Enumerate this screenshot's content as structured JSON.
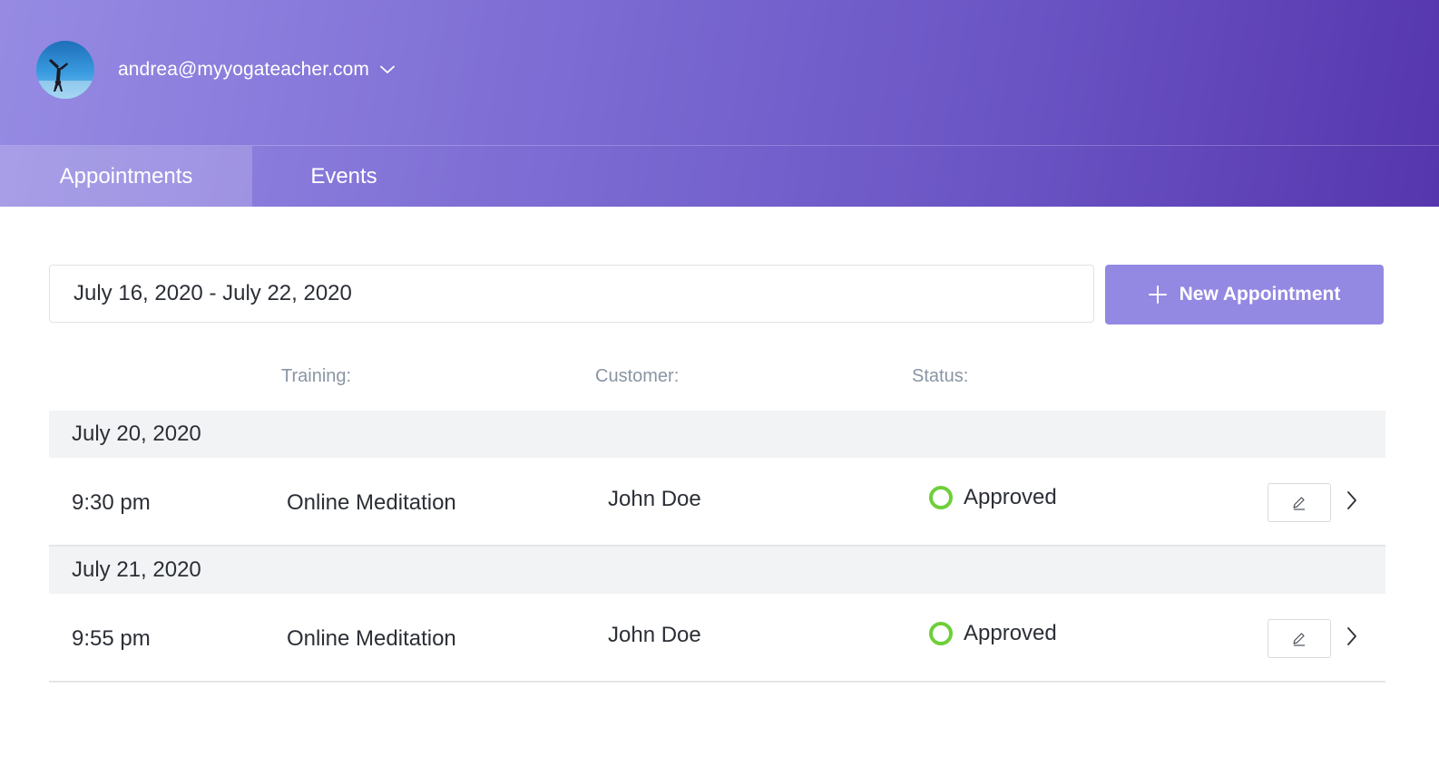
{
  "header": {
    "account_email": "andrea@myyogateacher.com",
    "avatar_icon": "avatar-image",
    "dropdown_icon": "chevron-down-icon"
  },
  "tabs": [
    {
      "label": "Appointments",
      "active": true
    },
    {
      "label": "Events",
      "active": false
    }
  ],
  "toolbar": {
    "date_range": "July 16, 2020 - July 22, 2020",
    "new_button_label": "New Appointment",
    "new_button_icon": "plus-icon"
  },
  "columns": {
    "training": "Training:",
    "customer": "Customer:",
    "status": "Status:"
  },
  "groups": [
    {
      "date": "July 20, 2020",
      "appointments": [
        {
          "time": "9:30 pm",
          "training": "Online Meditation",
          "customer": "John Doe",
          "status": "Approved"
        }
      ]
    },
    {
      "date": "July 21, 2020",
      "appointments": [
        {
          "time": "9:55 pm",
          "training": "Online Meditation",
          "customer": "John Doe",
          "status": "Approved"
        }
      ]
    }
  ],
  "colors": {
    "accent": "#9388e2",
    "status_approved": "#6fcf3a",
    "header_start": "#968be3",
    "header_end": "#5636ad"
  }
}
